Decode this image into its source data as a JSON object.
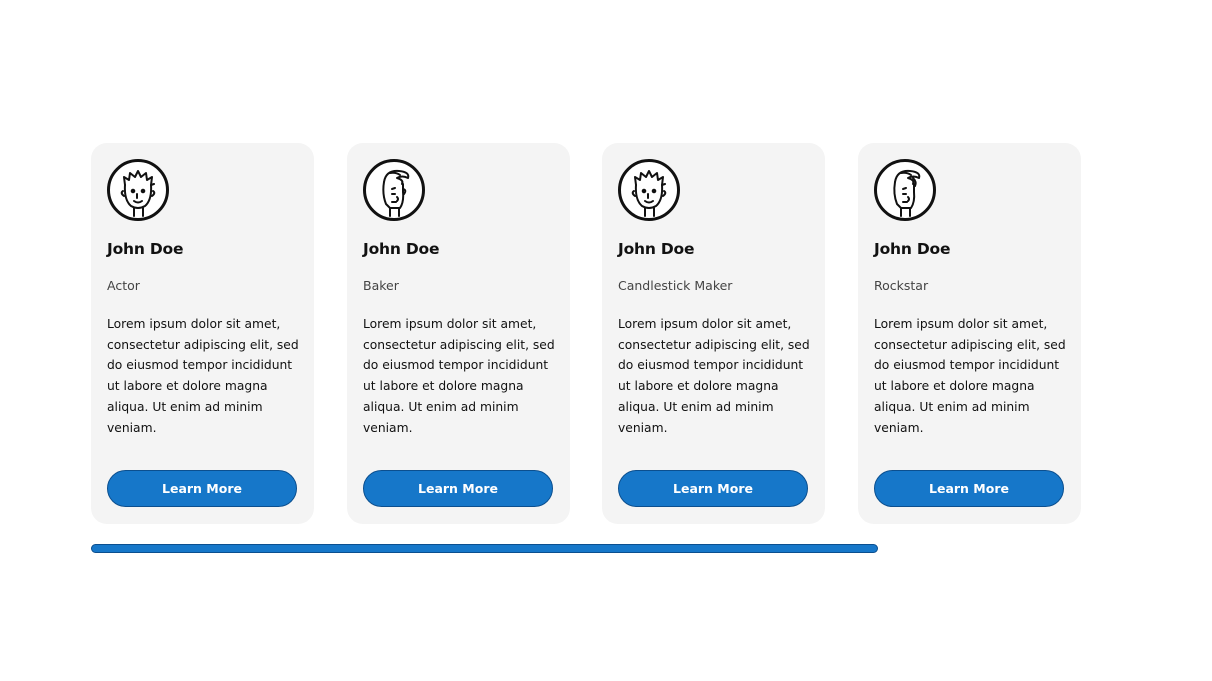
{
  "cards": [
    {
      "avatar_icon": "curly-hair-face-icon",
      "name": "John Doe",
      "role": "Actor",
      "description": "Lorem ipsum dolor sit amet, consectetur adipiscing elit, sed do eiusmod tempor incididunt ut labore et dolore magna aliqua. Ut enim ad minim veniam.",
      "button_label": "Learn More"
    },
    {
      "avatar_icon": "quiff-hair-face-icon",
      "name": "John Doe",
      "role": "Baker",
      "description": "Lorem ipsum dolor sit amet, consectetur adipiscing elit, sed do eiusmod tempor incididunt ut labore et dolore magna aliqua. Ut enim ad minim veniam.",
      "button_label": "Learn More"
    },
    {
      "avatar_icon": "curly-hair-face-icon",
      "name": "John Doe",
      "role": "Candlestick Maker",
      "description": "Lorem ipsum dolor sit amet, consectetur adipiscing elit, sed do eiusmod tempor incididunt ut labore et dolore magna aliqua. Ut enim ad minim veniam.",
      "button_label": "Learn More"
    },
    {
      "avatar_icon": "quiff-hair-face-icon",
      "name": "John Doe",
      "role": "Rockstar",
      "description": "Lorem ipsum dolor sit amet, consectetur adipiscing elit, sed do eiusmod tempor incididunt ut labore et dolore magna aliqua. Ut enim ad minim veniam.",
      "button_label": "Learn More"
    }
  ],
  "scrollbar": {
    "visible_fraction": 1.0
  },
  "colors": {
    "accent": "#1677c9",
    "accent_border": "#0b4f8f",
    "card_background": "#f4f4f4",
    "text": "#111111"
  }
}
